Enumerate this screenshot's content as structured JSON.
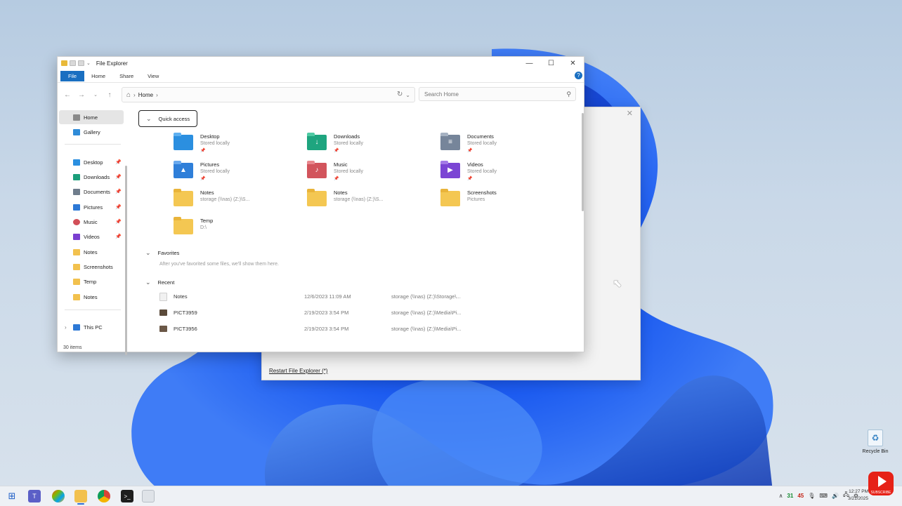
{
  "window": {
    "title": "File Explorer",
    "ribbon_tabs": [
      "File",
      "Home",
      "Share",
      "View"
    ],
    "help": "?",
    "minimize": "—",
    "maximize": "☐",
    "close": "✕"
  },
  "address": {
    "location": "Home",
    "separator": "›"
  },
  "search": {
    "placeholder": "Search Home"
  },
  "sidebar": {
    "items": [
      {
        "label": "Home",
        "icon": "home-icon",
        "color": "#8a8a8a"
      },
      {
        "label": "Gallery",
        "icon": "gallery-icon",
        "color": "#2f8bd8"
      },
      {
        "label": "Desktop",
        "icon": "desktop-icon",
        "color": "#2b8fe0"
      },
      {
        "label": "Downloads",
        "icon": "downloads-icon",
        "color": "#1b9e7a"
      },
      {
        "label": "Documents",
        "icon": "documents-icon",
        "color": "#6f7d8c"
      },
      {
        "label": "Pictures",
        "icon": "pictures-icon",
        "color": "#2d79d6"
      },
      {
        "label": "Music",
        "icon": "music-icon",
        "color": "#d24f58"
      },
      {
        "label": "Videos",
        "icon": "videos-icon",
        "color": "#7a3fd0"
      },
      {
        "label": "Notes",
        "icon": "folder-icon",
        "color": "#f2c14e"
      },
      {
        "label": "Screenshots",
        "icon": "folder-icon",
        "color": "#f2c14e"
      },
      {
        "label": "Temp",
        "icon": "folder-icon",
        "color": "#f2c14e"
      },
      {
        "label": "Notes",
        "icon": "folder-icon",
        "color": "#f2c14e"
      },
      {
        "label": "This PC",
        "icon": "pc-icon",
        "color": "#2d79d6"
      }
    ],
    "status": "30 items"
  },
  "quick_access": {
    "title": "Quick access",
    "tiles": [
      {
        "name": "Desktop",
        "sub": "Stored locally",
        "pinned": true,
        "color": "#2b8fe0",
        "glyph": ""
      },
      {
        "name": "Downloads",
        "sub": "Stored locally",
        "pinned": true,
        "color": "#1ea57f",
        "glyph": "↓"
      },
      {
        "name": "Documents",
        "sub": "Stored locally",
        "pinned": true,
        "color": "#76859a",
        "glyph": "≡"
      },
      {
        "name": "Pictures",
        "sub": "Stored locally",
        "pinned": true,
        "color": "#2f7fd9",
        "glyph": "▲"
      },
      {
        "name": "Music",
        "sub": "Stored locally",
        "pinned": true,
        "color": "#d2545c",
        "glyph": "♪"
      },
      {
        "name": "Videos",
        "sub": "Stored locally",
        "pinned": true,
        "color": "#7b45d4",
        "glyph": "▶"
      },
      {
        "name": "Notes",
        "sub": "storage (\\\\nas) (Z:)\\S...",
        "pinned": false,
        "color": "#f4c752",
        "glyph": ""
      },
      {
        "name": "Notes",
        "sub": "storage (\\\\nas) (Z:)\\S...",
        "pinned": false,
        "color": "#f4c752",
        "glyph": ""
      },
      {
        "name": "Screenshots",
        "sub": "Pictures",
        "pinned": false,
        "color": "#f4c752",
        "glyph": ""
      },
      {
        "name": "Temp",
        "sub": "D:\\",
        "pinned": false,
        "color": "#f4c752",
        "glyph": ""
      }
    ]
  },
  "favorites": {
    "title": "Favorites",
    "empty_message": "After you've favorited some files, we'll show them here."
  },
  "recent": {
    "title": "Recent",
    "rows": [
      {
        "name": "Notes",
        "date": "12/6/2023 11:09 AM",
        "location": "storage (\\\\nas) (Z:)\\Storage\\..."
      },
      {
        "name": "PICT3959",
        "date": "2/19/2023 3:54 PM",
        "location": "storage (\\\\nas) (Z:)\\Media\\Pi..."
      },
      {
        "name": "PICT3956",
        "date": "2/19/2023 3:54 PM",
        "location": "storage (\\\\nas) (Z:)\\Media\\Pi..."
      }
    ]
  },
  "back_dialog": {
    "link": "Restart File Explorer (*)",
    "close": "✕"
  },
  "desktop": {
    "recycle_label": "Recycle Bin"
  },
  "taskbar": {
    "tray": {
      "chevron": "∧",
      "temp_green": "31",
      "temp_red": "45"
    },
    "clock_time": "12:27 PM",
    "clock_date": "3/21/2025",
    "subscribe": "SUBSCRIBE"
  }
}
